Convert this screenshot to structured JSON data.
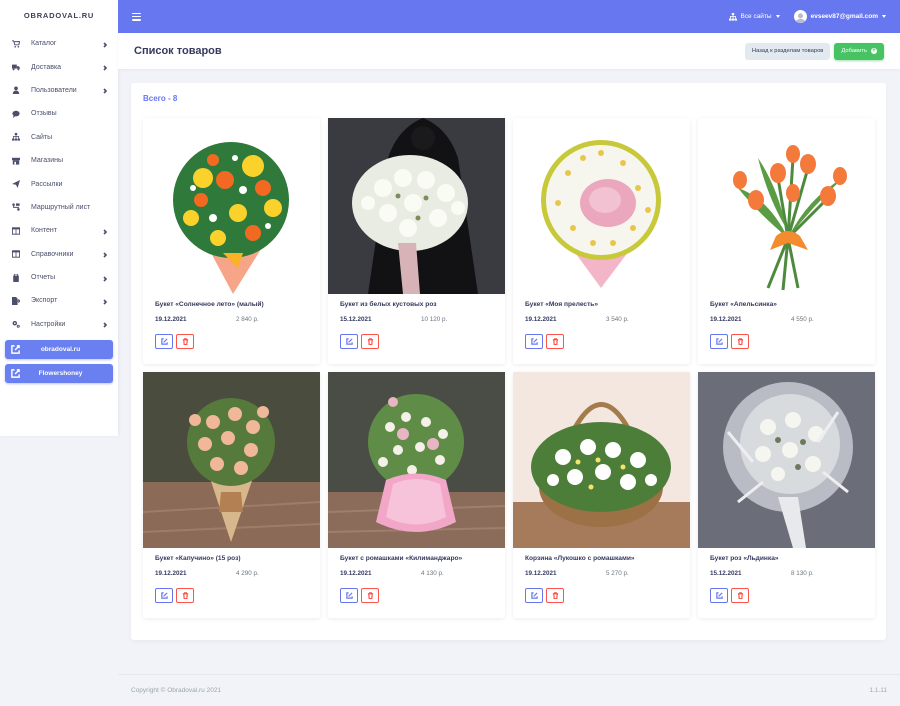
{
  "brand": "OBRADOVAL.RU",
  "sidebar": {
    "items": [
      {
        "label": "Каталог",
        "icon": "cart-icon",
        "chevron": true
      },
      {
        "label": "Доставка",
        "icon": "truck-icon",
        "chevron": true
      },
      {
        "label": "Пользователи",
        "icon": "user-icon",
        "chevron": true
      },
      {
        "label": "Отзывы",
        "icon": "comment-icon",
        "chevron": false
      },
      {
        "label": "Сайты",
        "icon": "sitemap-icon",
        "chevron": false
      },
      {
        "label": "Магазины",
        "icon": "store-icon",
        "chevron": false
      },
      {
        "label": "Рассылки",
        "icon": "paper-plane-icon",
        "chevron": false
      },
      {
        "label": "Маршрутный лист",
        "icon": "route-icon",
        "chevron": false
      },
      {
        "label": "Контент",
        "icon": "columns-icon",
        "chevron": true
      },
      {
        "label": "Справочники",
        "icon": "book-icon",
        "chevron": true
      },
      {
        "label": "Отчеты",
        "icon": "clipboard-icon",
        "chevron": true
      },
      {
        "label": "Экспорт",
        "icon": "export-icon",
        "chevron": true
      },
      {
        "label": "Настройки",
        "icon": "cogs-icon",
        "chevron": true
      }
    ],
    "sites": [
      "obradoval.ru",
      "Flowershoney"
    ]
  },
  "topbar": {
    "sites_label": "Все сайты",
    "user_email": "evseev87@gmail.com"
  },
  "header": {
    "title": "Список товаров",
    "back_label": "Назад к разделам товаров",
    "add_label": "Добавить"
  },
  "catalog": {
    "total_label": "Всего - 8",
    "products": [
      {
        "name": "Букет «Солнечное лето» (малый)",
        "date": "19.12.2021",
        "price": "2 840 р."
      },
      {
        "name": "Букет из белых кустовых роз",
        "date": "15.12.2021",
        "price": "10 120 р."
      },
      {
        "name": "Букет «Моя прелесть»",
        "date": "19.12.2021",
        "price": "3 540 р."
      },
      {
        "name": "Букет «Апельсинка»",
        "date": "19.12.2021",
        "price": "4 550 р."
      },
      {
        "name": "Букет «Капучино» (15 роз)",
        "date": "19.12.2021",
        "price": "4 290 р."
      },
      {
        "name": "Букет с ромашками «Килиманджаро»",
        "date": "19.12.2021",
        "price": "4 130 р."
      },
      {
        "name": "Корзина «Лукошко с ромашками»",
        "date": "19.12.2021",
        "price": "5 270 р."
      },
      {
        "name": "Букет роз «Льдинка»",
        "date": "15.12.2021",
        "price": "8 130 р."
      }
    ]
  },
  "footer": {
    "copyright": "Copyright © Obradoval.ru 2021",
    "version": "1.1.11"
  },
  "colors": {
    "primary": "#6777ef",
    "success": "#47c363",
    "danger": "#fc544b"
  }
}
